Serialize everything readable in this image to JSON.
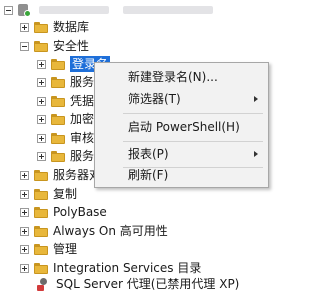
{
  "root": {
    "label_visible": false
  },
  "tree": {
    "items": [
      {
        "label": "数据库"
      },
      {
        "label": "安全性"
      },
      {
        "label": "登录名"
      },
      {
        "label": "服务"
      },
      {
        "label": "凭据"
      },
      {
        "label": "加密"
      },
      {
        "label": "审核"
      },
      {
        "label": "服务"
      },
      {
        "label": "服务器对"
      },
      {
        "label": "复制"
      },
      {
        "label": "PolyBase"
      },
      {
        "label": "Always On 高可用性"
      },
      {
        "label": "管理"
      },
      {
        "label": "Integration Services 目录"
      },
      {
        "label": "SQL Server 代理(已禁用代理 XP)"
      }
    ]
  },
  "context_menu": {
    "items": [
      {
        "label": "新建登录名(N)..."
      },
      {
        "label": "筛选器(T)",
        "submenu": true
      },
      {
        "label": "启动 PowerShell(H)"
      },
      {
        "label": "报表(P)",
        "submenu": true
      },
      {
        "label": "刷新(F)"
      }
    ]
  },
  "colors": {
    "selection": "#1e6fd9",
    "folder": "#e8b73b",
    "menu_bg": "#f2f2f2"
  }
}
